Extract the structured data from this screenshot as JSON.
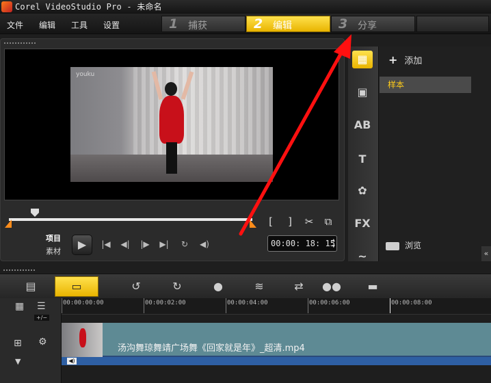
{
  "window": {
    "title": "Corel VideoStudio Pro - 未命名"
  },
  "menu": [
    "文件",
    "编辑",
    "工具",
    "设置"
  ],
  "steps": [
    {
      "num": "1",
      "label": "捕获"
    },
    {
      "num": "2",
      "label": "编辑",
      "active": true
    },
    {
      "num": "3",
      "label": "分享"
    }
  ],
  "preview": {
    "watermark": "youku",
    "mode_project": "项目",
    "mode_clip": "素材",
    "timecode": "00:00: 18: 15",
    "tools": [
      "[",
      "]",
      "✂",
      "⧉"
    ]
  },
  "library": {
    "add_label": "添加",
    "selected_item": "样本",
    "browse_label": "浏览",
    "sidebar_icons": [
      "media-icon",
      "transition-icon",
      "ab-title-icon",
      "text-icon",
      "graphic-icon",
      "fx-filter-icon",
      "path-icon"
    ]
  },
  "timeline": {
    "ruler_labels": [
      "00:00:00:00",
      "00:00:02:00",
      "00:00:04:00",
      "00:00:06:00",
      "00:00:08:00"
    ],
    "zoom_label": "+/−",
    "clip_name": "汤沟舞琼舞靖广场舞《回家就是年》_超清.mp4"
  },
  "colors": {
    "accent": "#f2c300",
    "annotation": "#ff1010",
    "clip": "#5e8a94",
    "audio": "#2e5fa3",
    "trim": "#ff8c1a"
  }
}
